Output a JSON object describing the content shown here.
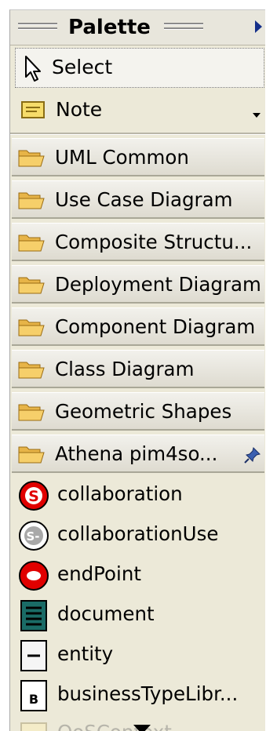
{
  "palette": {
    "title": "Palette",
    "tools": {
      "select_label": "Select",
      "note_label": "Note"
    },
    "drawers": [
      {
        "label": "UML Common"
      },
      {
        "label": "Use Case Diagram"
      },
      {
        "label": "Composite Structu..."
      },
      {
        "label": "Deployment Diagram"
      },
      {
        "label": "Component Diagram"
      },
      {
        "label": "Class Diagram"
      },
      {
        "label": "Geometric Shapes"
      },
      {
        "label": "Athena pim4so..."
      }
    ],
    "items": [
      {
        "label": "collaboration",
        "icon": "collaboration-icon"
      },
      {
        "label": "collaborationUse",
        "icon": "collaboration-use-icon"
      },
      {
        "label": "endPoint",
        "icon": "end-point-icon"
      },
      {
        "label": "document",
        "icon": "document-icon"
      },
      {
        "label": "entity",
        "icon": "entity-icon"
      },
      {
        "label": "businessTypeLibr...",
        "icon": "business-type-library-icon"
      },
      {
        "label": "QoSContext",
        "icon": "qos-context-icon"
      }
    ],
    "colors": {
      "background": "#ece9d8",
      "accent_arrow": "#15308a",
      "folder": "#f3c65a",
      "red_icon": "#e00000",
      "teal_icon": "#1a6b66"
    }
  }
}
